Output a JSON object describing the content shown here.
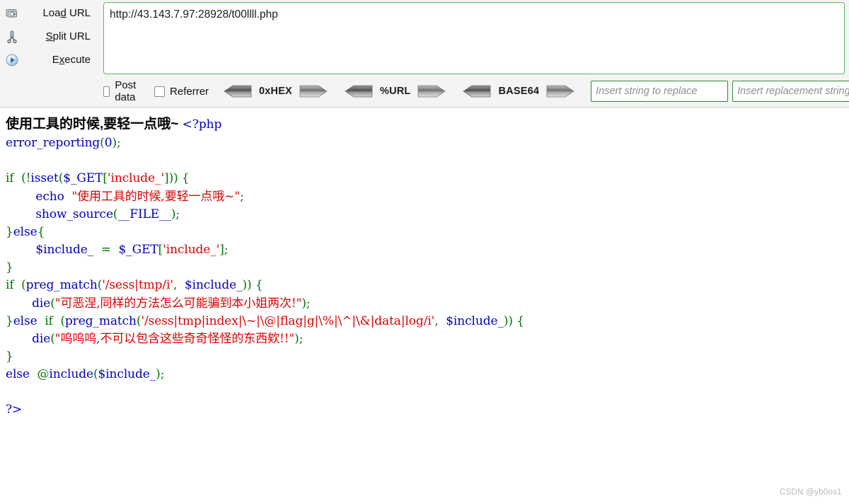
{
  "hackbar": {
    "actions": [
      {
        "label": "Load URL",
        "accel": "d",
        "icon": "load-url-icon",
        "name": "load-url-button"
      },
      {
        "label": "Split URL",
        "accel": "S",
        "icon": "scissors-icon",
        "name": "split-url-button"
      },
      {
        "label": "Execute",
        "accel": "x",
        "icon": "play-icon",
        "name": "execute-button"
      }
    ],
    "url_value": "http://43.143.7.97:28928/t00llll.php",
    "url_placeholder": "",
    "checkboxes": [
      {
        "label": "Post data",
        "checked": false,
        "name": "post-data-checkbox"
      },
      {
        "label": "Referrer",
        "checked": false,
        "name": "referrer-checkbox"
      }
    ],
    "codecs": [
      {
        "label": "0xHEX",
        "name": "hex-codec"
      },
      {
        "label": "%URL",
        "name": "url-codec"
      },
      {
        "label": "BASE64",
        "name": "base64-codec"
      }
    ],
    "replace_fields": [
      {
        "placeholder": "Insert string to replace",
        "value": "",
        "name": "replace-search-input"
      },
      {
        "placeholder": "Insert replacement string",
        "value": "",
        "name": "replace-with-input"
      }
    ],
    "colors": {
      "panel_bg": "#f4f4f4",
      "url_border": "#5cb85c",
      "field_border": "#2d8a33"
    }
  },
  "page": {
    "banner": "使用工具的时候,要轻一点哦~",
    "php_source_lines": [
      [
        {
          "t": "<?php",
          "c": "t"
        }
      ],
      [
        {
          "t": "error_reporting",
          "c": "d"
        },
        {
          "t": "(",
          "c": "k"
        },
        {
          "t": "0",
          "c": "d"
        },
        {
          "t": ");",
          "c": "k"
        }
      ],
      [],
      [
        {
          "t": "if  (",
          "c": "k"
        },
        {
          "t": "!",
          "c": "k"
        },
        {
          "t": "isset",
          "c": "d"
        },
        {
          "t": "(",
          "c": "k"
        },
        {
          "t": "$_GET",
          "c": "d"
        },
        {
          "t": "[",
          "c": "k"
        },
        {
          "t": "'include_'",
          "c": "s"
        },
        {
          "t": "])) {",
          "c": "k"
        }
      ],
      [
        {
          "t": "        echo  ",
          "c": "d"
        },
        {
          "t": "\"使用工具的时候,要轻一点哦~\"",
          "c": "s"
        },
        {
          "t": ";",
          "c": "k"
        }
      ],
      [
        {
          "t": "        show_source",
          "c": "d"
        },
        {
          "t": "(",
          "c": "k"
        },
        {
          "t": "__FILE__",
          "c": "d"
        },
        {
          "t": ");",
          "c": "k"
        }
      ],
      [
        {
          "t": "}",
          "c": "k"
        },
        {
          "t": "else",
          "c": "d"
        },
        {
          "t": "{",
          "c": "k"
        }
      ],
      [
        {
          "t": "        $include_",
          "c": "d"
        },
        {
          "t": "  =  ",
          "c": "k"
        },
        {
          "t": "$_GET",
          "c": "d"
        },
        {
          "t": "[",
          "c": "k"
        },
        {
          "t": "'include_'",
          "c": "s"
        },
        {
          "t": "];",
          "c": "k"
        }
      ],
      [
        {
          "t": "}",
          "c": "k"
        }
      ],
      [
        {
          "t": "if  (",
          "c": "k"
        },
        {
          "t": "preg_match",
          "c": "d"
        },
        {
          "t": "(",
          "c": "k"
        },
        {
          "t": "'/sess|tmp/i'",
          "c": "s"
        },
        {
          "t": ",  ",
          "c": "k"
        },
        {
          "t": "$include_",
          "c": "d"
        },
        {
          "t": ")) {",
          "c": "k"
        }
      ],
      [
        {
          "t": "       die",
          "c": "d"
        },
        {
          "t": "(",
          "c": "k"
        },
        {
          "t": "\"可恶涅,同样的方法怎么可能骗到本小姐两次!\"",
          "c": "s"
        },
        {
          "t": ");",
          "c": "k"
        }
      ],
      [
        {
          "t": "}",
          "c": "k"
        },
        {
          "t": "else",
          "c": "d"
        },
        {
          "t": "  if  (",
          "c": "k"
        },
        {
          "t": "preg_match",
          "c": "d"
        },
        {
          "t": "(",
          "c": "k"
        },
        {
          "t": "'/sess|tmp|index|\\~|\\@|flag|g|\\%|\\^|\\&|data|log/i'",
          "c": "s"
        },
        {
          "t": ",  ",
          "c": "k"
        },
        {
          "t": "$include_",
          "c": "d"
        },
        {
          "t": ")) {",
          "c": "k"
        }
      ],
      [
        {
          "t": "       die",
          "c": "d"
        },
        {
          "t": "(",
          "c": "k"
        },
        {
          "t": "\"呜呜呜,不可以包含这些奇奇怪怪的东西欸!!\"",
          "c": "s"
        },
        {
          "t": ");",
          "c": "k"
        }
      ],
      [
        {
          "t": "}",
          "c": "k"
        }
      ],
      [
        {
          "t": "else  ",
          "c": "d"
        },
        {
          "t": "@",
          "c": "k"
        },
        {
          "t": "include",
          "c": "d"
        },
        {
          "t": "(",
          "c": "k"
        },
        {
          "t": "$include_",
          "c": "d"
        },
        {
          "t": ");",
          "c": "k"
        }
      ],
      [],
      [
        {
          "t": "?>",
          "c": "t"
        }
      ]
    ],
    "watermark": "CSDN @yb0os1"
  }
}
